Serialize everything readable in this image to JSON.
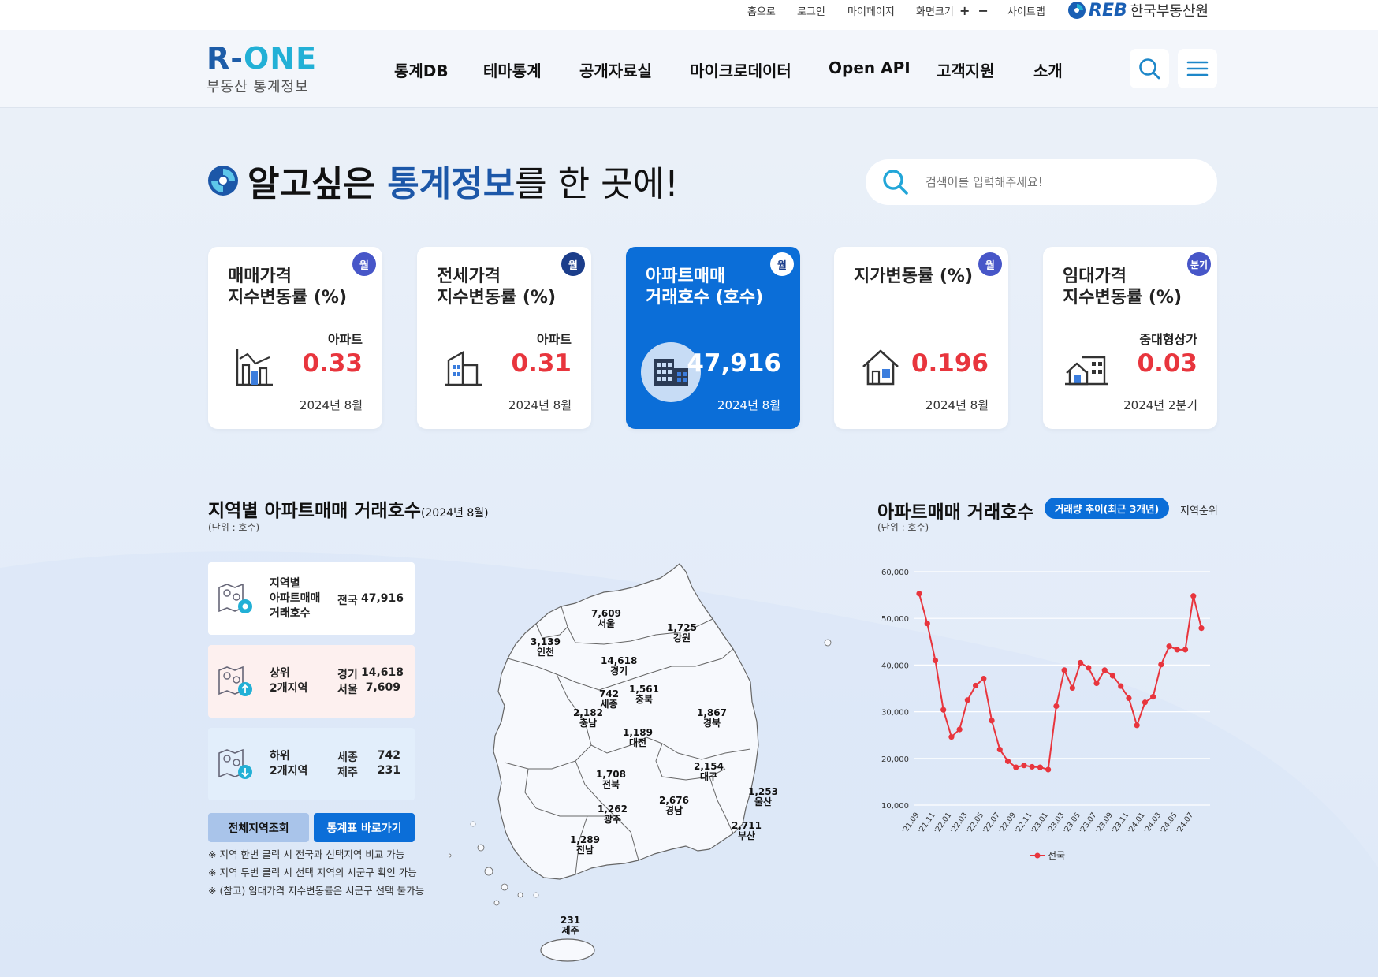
{
  "util": {
    "home": "홈으로",
    "login": "로그인",
    "mypage": "마이페이지",
    "screen_size": "화면크기",
    "zoom_in": "+",
    "zoom_out": "−",
    "sitemap": "사이트맵",
    "reb_name": "한국부동산원",
    "reb_mark": "REB"
  },
  "logo": {
    "main_r": "R-",
    "main_one": "ONE",
    "sub": "부동산 통계정보"
  },
  "menu": [
    "통계DB",
    "테마통계",
    "공개자료실",
    "마이크로데이터",
    "Open API",
    "고객지원",
    "소개"
  ],
  "hero": {
    "title_part1": "알고싶은 ",
    "title_blue": "통계정보",
    "title_rest": "를 한 곳에!"
  },
  "search": {
    "placeholder": "검색어를 입력해주세요!"
  },
  "cards": [
    {
      "title": "매매가격\n지수변동률 (%)",
      "badge": "월",
      "sub": "아파트",
      "value": "0.33",
      "date": "2024년 8월",
      "icon": "bar-chart-icon"
    },
    {
      "title": "전세가격\n지수변동률 (%)",
      "badge": "월",
      "sub": "아파트",
      "value": "0.31",
      "date": "2024년 8월",
      "icon": "apartment-icon"
    },
    {
      "title": "아파트매매\n거래호수 (호수)",
      "badge": "월",
      "sub": "",
      "value": "47,916",
      "date": "2024년 8월",
      "icon": "building-icon"
    },
    {
      "title": "지가변동률 (%)",
      "badge": "월",
      "sub": "",
      "value": "0.196",
      "date": "2024년 8월",
      "icon": "house-icon"
    },
    {
      "title": "임대가격\n지수변동률 (%)",
      "badge": "분기",
      "sub": "중대형상가",
      "value": "0.03",
      "date": "2024년 2분기",
      "icon": "shop-icon"
    }
  ],
  "region_section": {
    "title": "지역별 아파트매매 거래호수",
    "title_date": "(2024년 8월)",
    "unit": "(단위 : 호수)",
    "total": {
      "label": "지역별\n아파트매매\n거래호수",
      "region": "전국",
      "value": "47,916"
    },
    "top": {
      "label": "상위\n2개지역",
      "regions": [
        "경기",
        "서울"
      ],
      "values": [
        "14,618",
        "7,609"
      ]
    },
    "bottom": {
      "label": "하위\n2개지역",
      "regions": [
        "세종",
        "제주"
      ],
      "values": [
        "742",
        "231"
      ]
    },
    "btn_all": "전체지역조회",
    "btn_table": "통계표 바로가기",
    "notes": [
      "※ 지역 한번 클릭 시 전국과 선택지역 비교 가능",
      "※ 지역 두번 클릭 시 선택 지역의 시군구 확인 가능",
      "※ (참고) 임대가격 지수변동률은 시군구 선택 불가능"
    ]
  },
  "map_labels": [
    {
      "value": "7,609",
      "name": "서울"
    },
    {
      "value": "1,725",
      "name": "강원"
    },
    {
      "value": "3,139",
      "name": "인천"
    },
    {
      "value": "14,618",
      "name": "경기"
    },
    {
      "value": "742",
      "name": "세종"
    },
    {
      "value": "1,561",
      "name": "충북"
    },
    {
      "value": "2,182",
      "name": "충남"
    },
    {
      "value": "1,867",
      "name": "경북"
    },
    {
      "value": "1,189",
      "name": "대전"
    },
    {
      "value": "1,708",
      "name": "전북"
    },
    {
      "value": "2,154",
      "name": "대구"
    },
    {
      "value": "1,253",
      "name": "울산"
    },
    {
      "value": "2,676",
      "name": "경남"
    },
    {
      "value": "1,262",
      "name": "광주"
    },
    {
      "value": "2,711",
      "name": "부산"
    },
    {
      "value": "1,289",
      "name": "전남"
    },
    {
      "value": "231",
      "name": "제주"
    }
  ],
  "chart_section": {
    "title": "아파트매매 거래호수",
    "tab_active": "거래량 추이(최근 3개년)",
    "tab_other": "지역순위",
    "unit": "(단위 : 호수)"
  },
  "chart_data": {
    "type": "line",
    "title": "아파트매매 거래호수",
    "ylim": [
      10000,
      60000
    ],
    "yticks": [
      "10,000",
      "20,000",
      "30,000",
      "40,000",
      "50,000",
      "60,000"
    ],
    "xtick_labels": [
      "'21.09",
      "'21.11",
      "'22.01",
      "'22.03",
      "'22.05",
      "'22.07",
      "'22.09",
      "'22.11",
      "'23.01",
      "'23.03",
      "'23.05",
      "'23.07",
      "'23.09",
      "'23.11",
      "'24.01",
      "'24.03",
      "'24.05",
      "'24.07"
    ],
    "x": [
      "'21.09",
      "'21.10",
      "'21.11",
      "'21.12",
      "'22.01",
      "'22.02",
      "'22.03",
      "'22.04",
      "'22.05",
      "'22.06",
      "'22.07",
      "'22.08",
      "'22.09",
      "'22.10",
      "'22.11",
      "'22.12",
      "'23.01",
      "'23.02",
      "'23.03",
      "'23.04",
      "'23.05",
      "'23.06",
      "'23.07",
      "'23.08",
      "'23.09",
      "'23.10",
      "'23.11",
      "'23.12",
      "'24.01",
      "'24.02",
      "'24.03",
      "'24.04",
      "'24.05",
      "'24.06",
      "'24.07",
      "'24.08"
    ],
    "series": [
      {
        "name": "전국",
        "color": "#e8353d",
        "values": [
          55300,
          48900,
          41000,
          30400,
          24600,
          26200,
          32500,
          35600,
          37100,
          28100,
          21900,
          19400,
          18100,
          18500,
          18200,
          18100,
          17600,
          31200,
          38900,
          35100,
          40500,
          39400,
          36100,
          38900,
          37700,
          35500,
          32900,
          27100,
          32000,
          33200,
          40100,
          44000,
          43300,
          43300,
          54800,
          47900
        ]
      }
    ],
    "legend": "bottom",
    "grid": true
  }
}
